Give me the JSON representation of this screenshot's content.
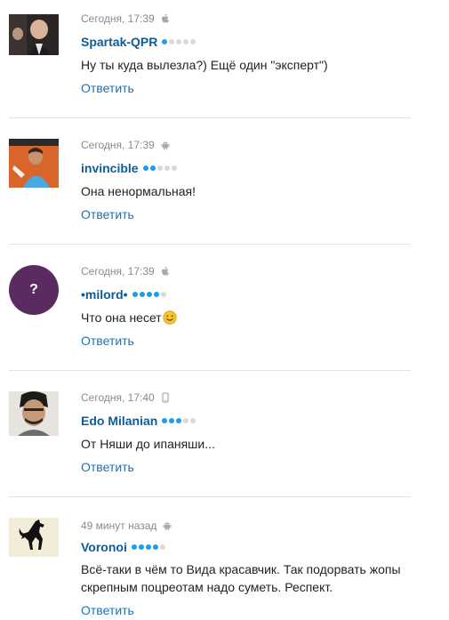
{
  "comments": [
    {
      "time": "Сегодня, 17:39",
      "device": "apple-icon",
      "author": "Spartak-QPR",
      "rating": 1,
      "text": "Ну ты куда вылезла?) Ещё один \"эксперт\")",
      "reply": "Ответить",
      "avatar": "photo-avatar"
    },
    {
      "time": "Сегодня, 17:39",
      "device": "android-icon",
      "author": "invincible",
      "rating": 2,
      "text": "Она ненормальная!",
      "reply": "Ответить",
      "avatar": "photo-avatar"
    },
    {
      "time": "Сегодня, 17:39",
      "device": "apple-icon",
      "author": "•milord•",
      "rating": 4,
      "text": "Что она несет",
      "emoji": "smiling-face-icon",
      "reply": "Ответить",
      "avatar_letter": "?",
      "avatar_color": "#5a2a60"
    },
    {
      "time": "Сегодня, 17:40",
      "device": "phone-icon",
      "author": "Edo Milanian",
      "rating": 3,
      "text": "От Няши до ипаняши...",
      "reply": "Ответить",
      "avatar": "photo-avatar"
    },
    {
      "time": "49 минут назад",
      "device": "android-icon",
      "author": "Voronoi",
      "rating": 4,
      "text": "Всё-таки в чём то Вида красавчик. Так подорвать жопы скрепным поцреотам надо суметь. Респект.",
      "reply": "Ответить",
      "avatar": "horse-logo-avatar"
    }
  ],
  "colors": {
    "author": "#0a5d99",
    "reply": "#1a73b8",
    "rating_on": "#1d9bf0",
    "rating_off": "#d9d9d9",
    "meta": "#8a8a8a"
  }
}
